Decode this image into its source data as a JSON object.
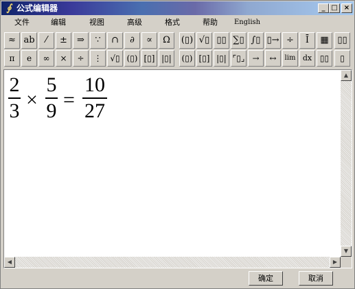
{
  "window": {
    "title": "公式编辑器",
    "title_icon": "∮",
    "minimize": "_",
    "restore": "□",
    "close": "×"
  },
  "menu": [
    "文件",
    "编辑",
    "视图",
    "高级",
    "格式",
    "帮助",
    "English"
  ],
  "toolbar_row1": [
    "≈",
    "ab",
    "⁄",
    "±",
    "⇒",
    "∵",
    "∩",
    "∂",
    "∝",
    "Ω",
    "(▯)",
    "√▯",
    "▯▯",
    "∑▯",
    "∫▯",
    "▯→",
    "÷",
    "Ī",
    "▦",
    "▯▯"
  ],
  "toolbar_row2": [
    "π",
    "e",
    "∞",
    "×",
    "÷",
    "⋮",
    "√▯",
    "(▯)",
    "[▯]",
    "|▯|",
    "(▯)",
    "[▯]",
    "|▯|",
    "⌜▯⌟",
    "→",
    "↔",
    "lim",
    "dx",
    "▯▯",
    "▯"
  ],
  "formula": {
    "frac1": {
      "num": "2",
      "den": "3"
    },
    "times": "×",
    "frac2": {
      "num": "5",
      "den": "9"
    },
    "equals": "=",
    "frac3": {
      "num": "10",
      "den": "27"
    }
  },
  "scrollbar": {
    "up": "▲",
    "down": "▼",
    "left": "◀",
    "right": "▶"
  },
  "buttons": {
    "ok": "确定",
    "cancel": "取消"
  },
  "colors": {
    "titlebar_start": "#10246a",
    "titlebar_end": "#a6caf0",
    "face": "#d4d0c8"
  }
}
